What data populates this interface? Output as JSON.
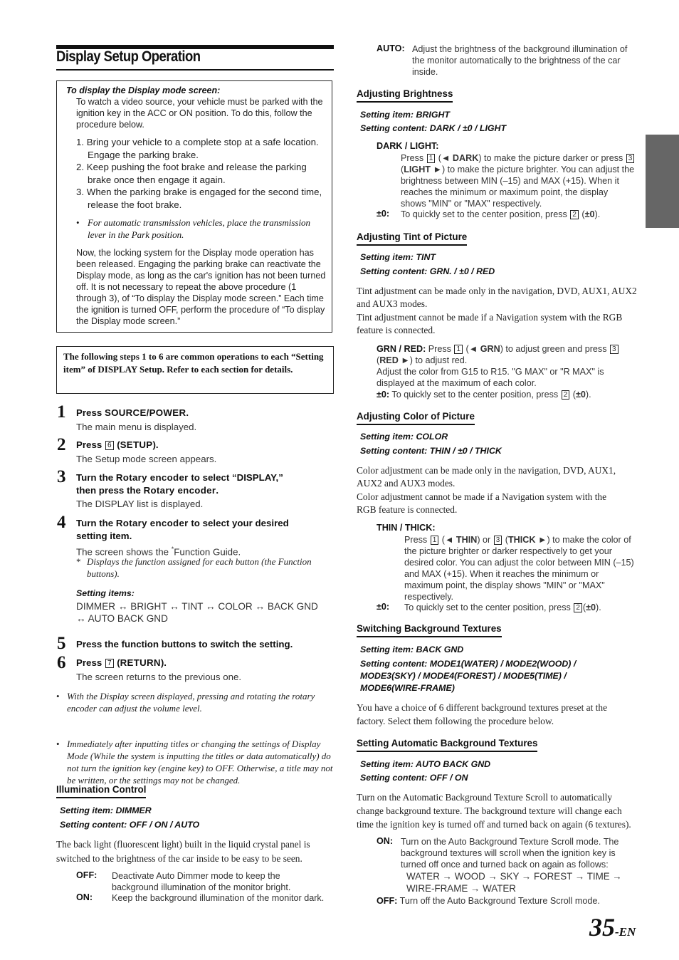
{
  "page": {
    "title": "Display Setup Operation",
    "page_number": "35",
    "page_suffix": "-EN",
    "side_tab_color": "#666666"
  },
  "box1": {
    "header": "To display the Display mode screen:",
    "intro": "To watch a video source, your vehicle must be parked with the ignition key in the ACC or ON position. To do this, follow the procedure below.",
    "steps": [
      "1. Bring your vehicle to a complete stop at a safe location. Engage the parking brake.",
      "2. Keep pushing the foot brake and release the parking brake once then engage it again.",
      "3. When the parking brake is engaged for the second time, release the foot brake."
    ],
    "bullet": "For automatic transmission vehicles, place the transmission lever in the Park position.",
    "note": "Now, the locking system for the Display mode operation has been released. Engaging the parking brake can reactivate the Display mode, as long as the car's ignition has not been turned off.  It is not necessary to repeat the above procedure (1 through 3),  of “To display the Display mode screen.” Each time the ignition is turned OFF, perform the procedure of “To display the Display mode screen.”"
  },
  "box2": {
    "text": "The following steps 1 to 6 are common operations to each “Setting item” of DISPLAY Setup.  Refer to each section for details."
  },
  "steps": [
    {
      "num": "1",
      "pre": "Press ",
      "key": "",
      "bold": "SOURCE/POWER",
      "post": ".",
      "sub": "The main menu is displayed."
    },
    {
      "num": "2",
      "pre": "Press ",
      "key": "6",
      "bold": "SETUP",
      "post": ").",
      "open": " (",
      "sub": "The Setup mode screen appears."
    },
    {
      "num": "3",
      "line1_pre": "Turn the ",
      "line1_bold": "Rotary encoder",
      "line1_post": " to select “DISPLAY,”",
      "line2_pre": "then press the ",
      "line2_bold": "Rotary encoder",
      "line2_post": ".",
      "sub": "The DISPLAY list is displayed."
    },
    {
      "num": "4",
      "line1_pre": "Turn the ",
      "line1_bold": "Rotary encoder",
      "line1_post": " to select your desired",
      "line2": "setting item.",
      "sub": "The screen shows the ",
      "sub_sup": "*",
      "sub_post": "Function Guide.",
      "footnote_mark": "*",
      "footnote": "Displays the function assigned for each button (the Function buttons).",
      "items_label": "Setting items:",
      "items": "DIMMER ↔ BRIGHT ↔ TINT ↔ COLOR ↔ BACK GND ↔ AUTO BACK GND"
    },
    {
      "num": "5",
      "text": "Press the function buttons to switch the setting."
    },
    {
      "num": "6",
      "pre": "Press ",
      "key": "7",
      "open": " (",
      "bold": "RETURN",
      "post": ").",
      "sub": "The screen returns to the previous one."
    }
  ],
  "notes": [
    "With the Display screen displayed, pressing and rotating the rotary encoder can adjust the volume level.",
    "Immediately after inputting titles or changing the settings of Display Mode  (While the system is inputting the titles or data automatically) do not turn the ignition key (engine key) to OFF. Otherwise, a title may not be written, or the settings may not be changed."
  ],
  "illumination": {
    "title": "Illumination Control",
    "item": "Setting item: DIMMER",
    "content": "Setting content: OFF / ON / AUTO",
    "body": "The back light (fluorescent light) built in the liquid crystal panel is switched to the brightness of the car inside to be easy to be seen.",
    "off_term": "OFF:",
    "off_desc": "Deactivate Auto Dimmer mode to keep the background illumination of the monitor bright.",
    "on_term": "ON:",
    "on_desc": "Keep the background illumination of the monitor dark.",
    "auto_term": "AUTO:",
    "auto_desc": "Adjust the brightness of the background illumination of the monitor automatically to the brightness of the car inside."
  },
  "brightness": {
    "title": "Adjusting Brightness",
    "item": "Setting item: BRIGHT",
    "content": "Setting content: DARK / ±0 / LIGHT",
    "term": "DARK / LIGHT:",
    "d1": "Press ",
    "k1": "1",
    "b1": "◄ DARK",
    "d2": ") to make the picture darker or press ",
    "k2": "3",
    "b2": "LIGHT ►",
    "d3": ") to make the picture brighter. You can adjust the brightness between MIN (–15) and MAX (+15). When it reaches the minimum or maximum point, the display shows \"MIN\" or \"MAX\" respectively.",
    "zero_term": "±0:",
    "zero_desc": "To quickly set to the center position, press ",
    "zero_key": "2",
    "zero_bold": "±0"
  },
  "tint": {
    "title": "Adjusting Tint of Picture",
    "item": "Setting item: TINT",
    "content": "Setting content: GRN. / ±0 / RED",
    "body1": "Tint adjustment can be made only in the navigation, DVD, AUX1, AUX2 and AUX3 modes.",
    "body2": "Tint adjustment cannot be made if a Navigation system with the RGB feature is connected.",
    "term": "GRN / RED:",
    "d1": " Press ",
    "k1": "1",
    "b1": "◄ GRN",
    "d2": ") to adjust green and press ",
    "k2": "3",
    "b2": "RED ►",
    "d3": ") to adjust red.",
    "d4": "Adjust the color from G15 to R15.  \"G MAX\" or \"R MAX\" is displayed at the  maximum of each color.",
    "zero_term": "±0:",
    "zero_desc": " To quickly set to the center position, press ",
    "zero_key": "2",
    "zero_bold": "±0"
  },
  "color": {
    "title": "Adjusting Color of Picture",
    "item": "Setting item: COLOR",
    "content": "Setting content: THIN / ±0 / THICK",
    "body1": "Color adjustment can be made only in the navigation, DVD, AUX1, AUX2 and AUX3 modes.",
    "body2": "Color adjustment cannot be made if a Navigation system with the RGB feature is connected.",
    "term": "THIN / THICK:",
    "d1": "Press ",
    "k1": "1",
    "b1": "◄ THIN",
    "d2": ") or ",
    "k2": "3",
    "b2": "THICK ►",
    "d3": ") to make the color of the picture brighter or darker respectively to get your desired color. You can adjust the color between MIN (–15) and MAX (+15). When it reaches the minimum or maximum point, the display shows \"MIN\" or \"MAX\" respectively.",
    "zero_term": "±0:",
    "zero_desc": "To quickly set to the center position, press ",
    "zero_key": "2",
    "zero_bold": "±0"
  },
  "backgnd": {
    "title": "Switching Background Textures",
    "item": "Setting item: BACK GND",
    "content": "Setting content: MODE1(WATER) / MODE2(WOOD) / MODE3(SKY) / MODE4(FOREST) / MODE5(TIME) / MODE6(WIRE-FRAME)",
    "body": "You have a choice of 6 different background textures preset at the factory. Select them following the procedure below."
  },
  "autobackgnd": {
    "title": "Setting Automatic Background Textures",
    "item": "Setting item: AUTO BACK GND",
    "content": "Setting content: OFF / ON",
    "body": "Turn on the Automatic Background Texture Scroll to automatically change background texture. The background texture will change each time the ignition key is turned off and turned back on again (6 textures).",
    "on_term": "ON:",
    "on_desc": "Turn on the Auto Background Texture Scroll mode. The background textures will scroll when the ignition key is turned off once and turned back on again as follows:",
    "sequence1": "WATER → WOOD → SKY → FOREST → TIME →",
    "sequence2": "WIRE-FRAME → WATER",
    "off_term": "OFF:",
    "off_desc": " Turn off the Auto Background Texture Scroll mode."
  }
}
